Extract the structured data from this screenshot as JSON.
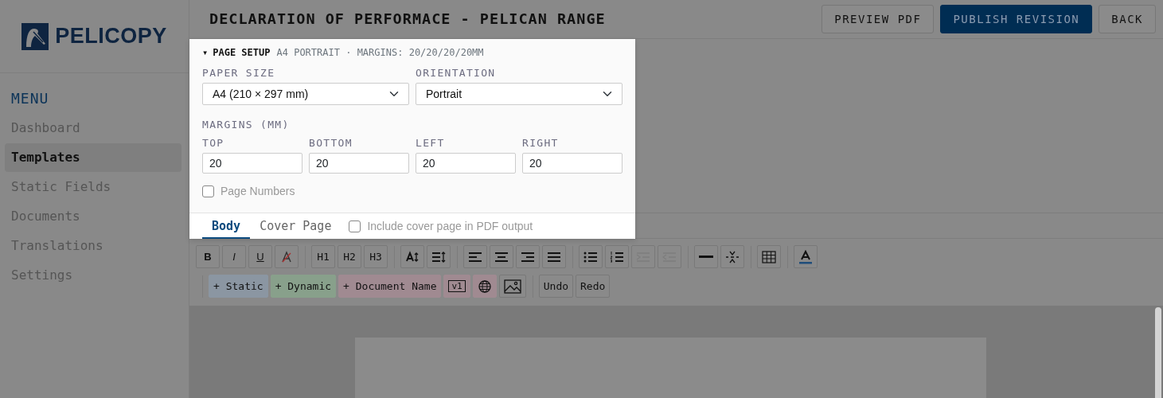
{
  "brand": {
    "name": "PELICOPY"
  },
  "sidebar": {
    "heading": "MENU",
    "items": [
      {
        "label": "Dashboard",
        "selected": false
      },
      {
        "label": "Templates",
        "selected": true
      },
      {
        "label": "Static Fields",
        "selected": false
      },
      {
        "label": "Documents",
        "selected": false
      },
      {
        "label": "Translations",
        "selected": false
      },
      {
        "label": "Settings",
        "selected": false
      }
    ]
  },
  "header": {
    "title": "DECLARATION OF PERFORMACE - PELICAN RANGE",
    "buttons": [
      {
        "label": "PREVIEW PDF",
        "kind": "outline"
      },
      {
        "label": "PUBLISH REVISION",
        "kind": "primary"
      },
      {
        "label": "BACK",
        "kind": "outline"
      }
    ]
  },
  "page_setup": {
    "caret": "▾",
    "title": "PAGE SETUP",
    "summary": "A4 PORTRAIT · MARGINS: 20/20/20/20MM",
    "paper_size": {
      "label": "PAPER SIZE",
      "value": "A4 (210 × 297 mm)"
    },
    "orientation": {
      "label": "ORIENTATION",
      "value": "Portrait"
    },
    "margins": {
      "label": "MARGINS (MM)",
      "fields": [
        {
          "label": "TOP",
          "value": "20"
        },
        {
          "label": "BOTTOM",
          "value": "20"
        },
        {
          "label": "LEFT",
          "value": "20"
        },
        {
          "label": "RIGHT",
          "value": "20"
        }
      ]
    },
    "page_numbers": {
      "label": "Page Numbers",
      "checked": false
    }
  },
  "tabs": [
    {
      "label": "Body",
      "selected": true
    },
    {
      "label": "Cover Page",
      "selected": false
    }
  ],
  "include_cover": {
    "label": "Include cover page in PDF output",
    "checked": false
  },
  "toolbar": {
    "groups": [
      [
        {
          "kind": "bold",
          "label": "B",
          "disabled": false
        },
        {
          "kind": "italic",
          "label": "I",
          "disabled": false
        },
        {
          "kind": "underline",
          "label": "U",
          "disabled": false
        },
        {
          "kind": "clear",
          "disabled": false
        }
      ],
      [
        {
          "kind": "text",
          "label": "H1",
          "disabled": false
        },
        {
          "kind": "text",
          "label": "H2",
          "disabled": false
        },
        {
          "kind": "text",
          "label": "H3",
          "disabled": false
        }
      ],
      [
        {
          "kind": "fontsize",
          "disabled": false
        },
        {
          "kind": "lineheight",
          "disabled": false
        }
      ],
      [
        {
          "kind": "alignleft",
          "disabled": false
        },
        {
          "kind": "aligncenter",
          "disabled": false
        },
        {
          "kind": "alignright",
          "disabled": false
        },
        {
          "kind": "justify",
          "disabled": false
        }
      ],
      [
        {
          "kind": "bullets",
          "disabled": false
        },
        {
          "kind": "numbers",
          "disabled": false
        },
        {
          "kind": "indent",
          "disabled": true
        },
        {
          "kind": "outdent",
          "disabled": true
        }
      ],
      [
        {
          "kind": "rule",
          "disabled": false
        },
        {
          "kind": "pagebreak",
          "disabled": false
        }
      ],
      [
        {
          "kind": "table",
          "disabled": false
        }
      ],
      [
        {
          "kind": "textcolor",
          "disabled": false
        }
      ]
    ],
    "inserts": [
      [
        {
          "kind": "tag",
          "label": "+ Static",
          "color": "#8b96a2"
        },
        {
          "kind": "tag",
          "label": "+ Dynamic",
          "color": "#88a08b"
        },
        {
          "kind": "tag",
          "label": "+ Document Name",
          "color": "#a08a91"
        },
        {
          "kind": "version",
          "label": "v1",
          "color": "#a08a91"
        },
        {
          "kind": "globe",
          "color": "#a08a91"
        },
        {
          "kind": "image"
        }
      ],
      [
        {
          "kind": "tag",
          "label": "Undo"
        },
        {
          "kind": "tag",
          "label": "Redo"
        }
      ]
    ]
  }
}
